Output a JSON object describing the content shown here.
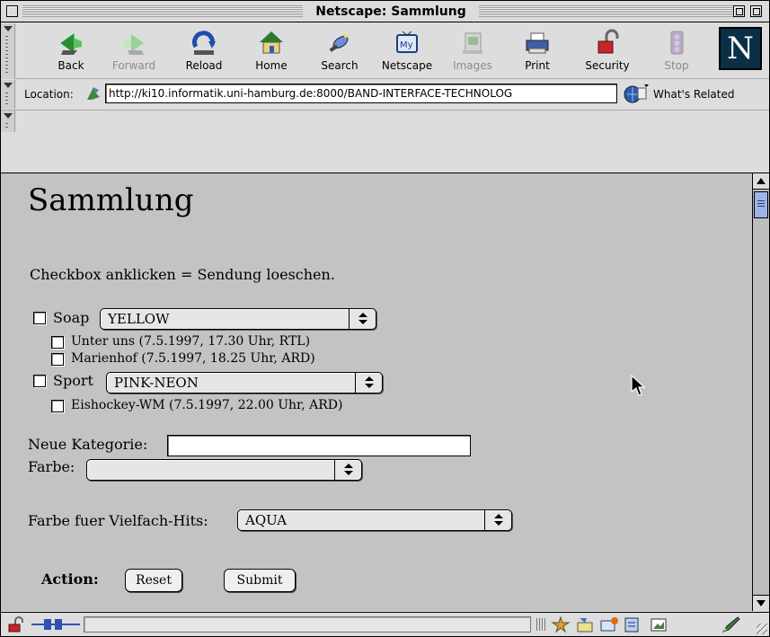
{
  "window": {
    "title": "Netscape: Sammlung"
  },
  "toolbar": {
    "buttons": [
      {
        "label": "Back",
        "icon": "back-arrow-icon",
        "enabled": true
      },
      {
        "label": "Forward",
        "icon": "forward-arrow-icon",
        "enabled": false
      },
      {
        "label": "Reload",
        "icon": "reload-icon",
        "enabled": true
      },
      {
        "label": "Home",
        "icon": "home-icon",
        "enabled": true
      },
      {
        "label": "Search",
        "icon": "search-icon",
        "enabled": true
      },
      {
        "label": "Netscape",
        "icon": "netscape-my-icon",
        "enabled": true
      },
      {
        "label": "Images",
        "icon": "images-icon",
        "enabled": false
      },
      {
        "label": "Print",
        "icon": "printer-icon",
        "enabled": true
      },
      {
        "label": "Security",
        "icon": "padlock-icon",
        "enabled": true
      },
      {
        "label": "Stop",
        "icon": "stop-icon",
        "enabled": false
      }
    ],
    "logo": "N"
  },
  "location": {
    "label": "Location:",
    "url": "http://ki10.informatik.uni-hamburg.de:8000/BAND-INTERFACE-TECHNOLOG",
    "related_label": "What's Related"
  },
  "page": {
    "heading": "Sammlung",
    "instruction": "Checkbox anklicken = Sendung loeschen.",
    "categories": [
      {
        "name": "Soap",
        "color": "YELLOW",
        "items": [
          "Unter uns (7.5.1997, 17.30 Uhr, RTL)",
          "Marienhof (7.5.1997, 18.25 Uhr, ARD)"
        ]
      },
      {
        "name": "Sport",
        "color": "PINK-NEON",
        "items": [
          "Eishockey-WM (7.5.1997, 22.00 Uhr, ARD)"
        ]
      }
    ],
    "new_category_label": "Neue Kategorie:",
    "new_category_value": "",
    "color_label": "Farbe:",
    "color_value": "",
    "multi_hit_label": "Farbe fuer Vielfach-Hits:",
    "multi_hit_value": "AQUA",
    "action_label": "Action:",
    "reset_label": "Reset",
    "submit_label": "Submit"
  },
  "colors": {
    "content_bg": "#c3c3c3",
    "chrome_bg": "#dddddd",
    "scroll_thumb": "#9fb3e8"
  }
}
